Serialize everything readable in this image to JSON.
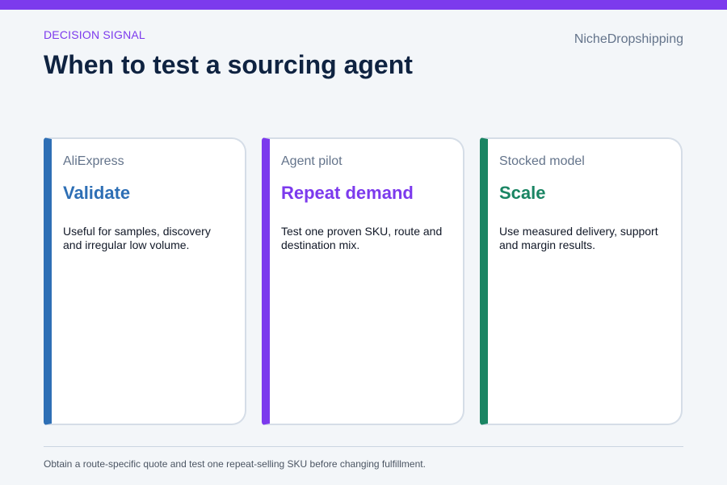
{
  "header": {
    "eyebrow": "DECISION SIGNAL",
    "title": "When to test a sourcing agent",
    "brand": "NicheDropshipping"
  },
  "cards": [
    {
      "label": "AliExpress",
      "heading": "Validate",
      "body": "Useful for samples, discovery and irregular low volume.",
      "accent": "#2e6fb5"
    },
    {
      "label": "Agent pilot",
      "heading": "Repeat demand",
      "body": "Test one proven SKU, route and destination mix.",
      "accent": "#7c3aed"
    },
    {
      "label": "Stocked model",
      "heading": "Scale",
      "body": "Use measured delivery, support and margin results.",
      "accent": "#1a8563"
    }
  ],
  "footer": {
    "note": "Obtain a route-specific quote and test one repeat-selling SKU before changing fulfillment."
  },
  "colors": {
    "top_bar": "#7c3aed",
    "title": "#0f2341",
    "background": "#f3f6f9"
  }
}
